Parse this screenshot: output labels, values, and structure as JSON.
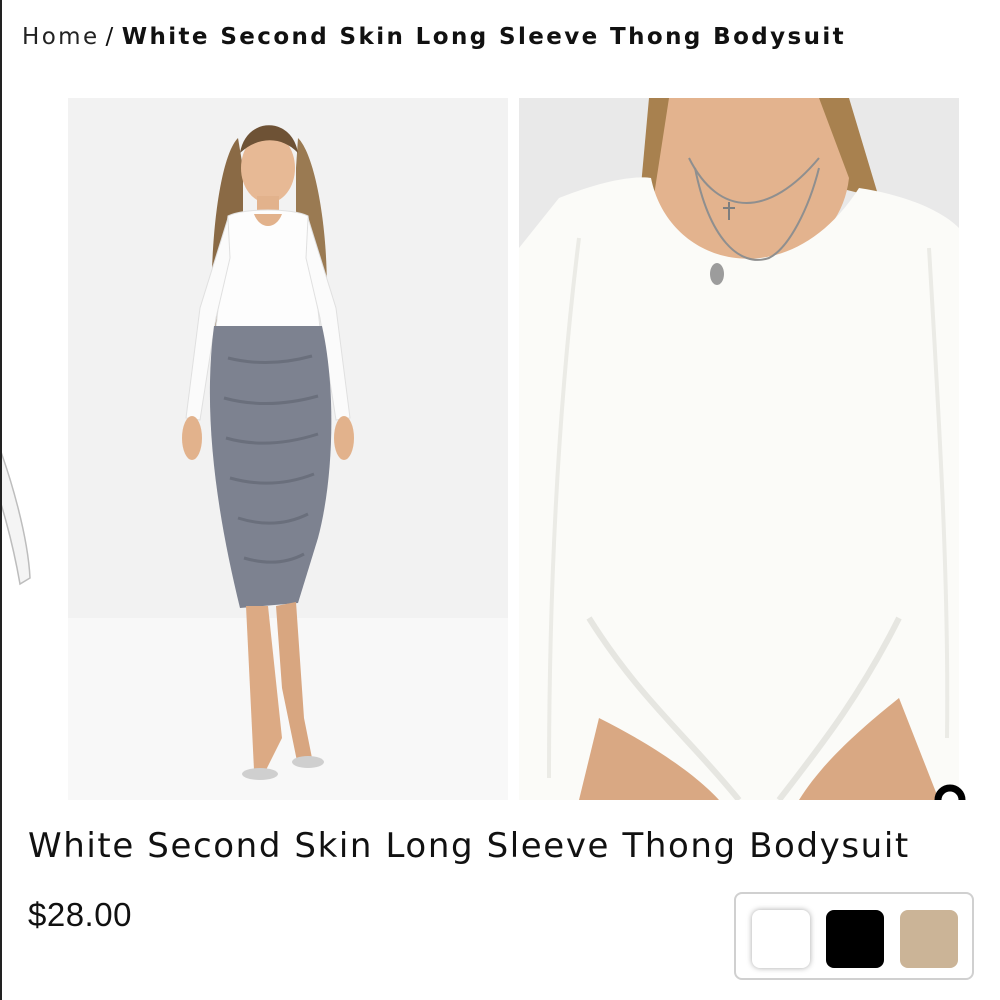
{
  "breadcrumb": {
    "home": "Home",
    "separator": "/",
    "current": "White Second Skin Long Sleeve Thong Bodysuit"
  },
  "gallery": {
    "images": [
      {
        "alt": "model-full-length"
      },
      {
        "alt": "model-close-up"
      }
    ]
  },
  "share": {
    "icon": "share-icon"
  },
  "product": {
    "title": "White Second Skin Long Sleeve Thong Bodysuit",
    "price": "$28.00"
  },
  "swatches": [
    {
      "name": "white",
      "color": "#ffffff"
    },
    {
      "name": "black",
      "color": "#000000"
    },
    {
      "name": "nude",
      "color": "#cbb497"
    }
  ]
}
